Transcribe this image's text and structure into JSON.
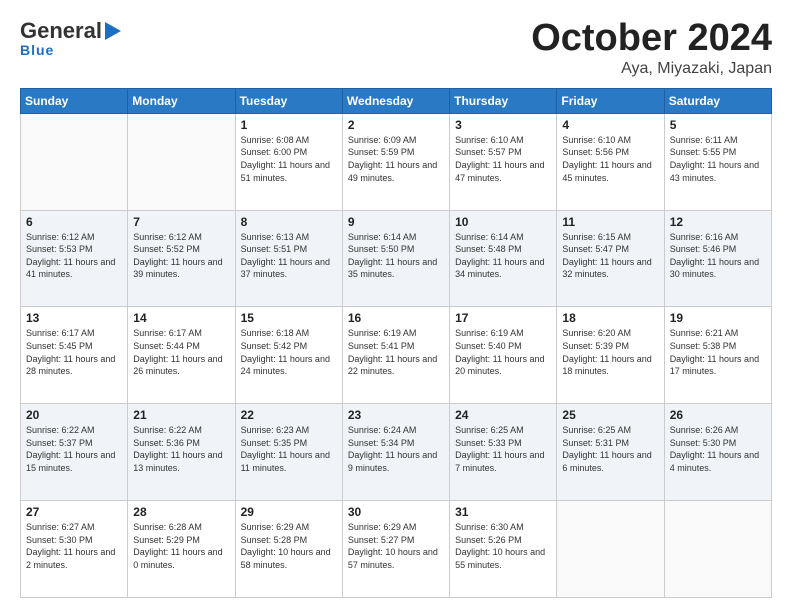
{
  "header": {
    "logo_general": "General",
    "logo_blue": "Blue",
    "month_year": "October 2024",
    "location": "Aya, Miyazaki, Japan"
  },
  "days_of_week": [
    "Sunday",
    "Monday",
    "Tuesday",
    "Wednesday",
    "Thursday",
    "Friday",
    "Saturday"
  ],
  "weeks": [
    [
      {
        "day": "",
        "info": ""
      },
      {
        "day": "",
        "info": ""
      },
      {
        "day": "1",
        "sunrise": "6:08 AM",
        "sunset": "6:00 PM",
        "daylight": "11 hours and 51 minutes."
      },
      {
        "day": "2",
        "sunrise": "6:09 AM",
        "sunset": "5:59 PM",
        "daylight": "11 hours and 49 minutes."
      },
      {
        "day": "3",
        "sunrise": "6:10 AM",
        "sunset": "5:57 PM",
        "daylight": "11 hours and 47 minutes."
      },
      {
        "day": "4",
        "sunrise": "6:10 AM",
        "sunset": "5:56 PM",
        "daylight": "11 hours and 45 minutes."
      },
      {
        "day": "5",
        "sunrise": "6:11 AM",
        "sunset": "5:55 PM",
        "daylight": "11 hours and 43 minutes."
      }
    ],
    [
      {
        "day": "6",
        "sunrise": "6:12 AM",
        "sunset": "5:53 PM",
        "daylight": "11 hours and 41 minutes."
      },
      {
        "day": "7",
        "sunrise": "6:12 AM",
        "sunset": "5:52 PM",
        "daylight": "11 hours and 39 minutes."
      },
      {
        "day": "8",
        "sunrise": "6:13 AM",
        "sunset": "5:51 PM",
        "daylight": "11 hours and 37 minutes."
      },
      {
        "day": "9",
        "sunrise": "6:14 AM",
        "sunset": "5:50 PM",
        "daylight": "11 hours and 35 minutes."
      },
      {
        "day": "10",
        "sunrise": "6:14 AM",
        "sunset": "5:48 PM",
        "daylight": "11 hours and 34 minutes."
      },
      {
        "day": "11",
        "sunrise": "6:15 AM",
        "sunset": "5:47 PM",
        "daylight": "11 hours and 32 minutes."
      },
      {
        "day": "12",
        "sunrise": "6:16 AM",
        "sunset": "5:46 PM",
        "daylight": "11 hours and 30 minutes."
      }
    ],
    [
      {
        "day": "13",
        "sunrise": "6:17 AM",
        "sunset": "5:45 PM",
        "daylight": "11 hours and 28 minutes."
      },
      {
        "day": "14",
        "sunrise": "6:17 AM",
        "sunset": "5:44 PM",
        "daylight": "11 hours and 26 minutes."
      },
      {
        "day": "15",
        "sunrise": "6:18 AM",
        "sunset": "5:42 PM",
        "daylight": "11 hours and 24 minutes."
      },
      {
        "day": "16",
        "sunrise": "6:19 AM",
        "sunset": "5:41 PM",
        "daylight": "11 hours and 22 minutes."
      },
      {
        "day": "17",
        "sunrise": "6:19 AM",
        "sunset": "5:40 PM",
        "daylight": "11 hours and 20 minutes."
      },
      {
        "day": "18",
        "sunrise": "6:20 AM",
        "sunset": "5:39 PM",
        "daylight": "11 hours and 18 minutes."
      },
      {
        "day": "19",
        "sunrise": "6:21 AM",
        "sunset": "5:38 PM",
        "daylight": "11 hours and 17 minutes."
      }
    ],
    [
      {
        "day": "20",
        "sunrise": "6:22 AM",
        "sunset": "5:37 PM",
        "daylight": "11 hours and 15 minutes."
      },
      {
        "day": "21",
        "sunrise": "6:22 AM",
        "sunset": "5:36 PM",
        "daylight": "11 hours and 13 minutes."
      },
      {
        "day": "22",
        "sunrise": "6:23 AM",
        "sunset": "5:35 PM",
        "daylight": "11 hours and 11 minutes."
      },
      {
        "day": "23",
        "sunrise": "6:24 AM",
        "sunset": "5:34 PM",
        "daylight": "11 hours and 9 minutes."
      },
      {
        "day": "24",
        "sunrise": "6:25 AM",
        "sunset": "5:33 PM",
        "daylight": "11 hours and 7 minutes."
      },
      {
        "day": "25",
        "sunrise": "6:25 AM",
        "sunset": "5:31 PM",
        "daylight": "11 hours and 6 minutes."
      },
      {
        "day": "26",
        "sunrise": "6:26 AM",
        "sunset": "5:30 PM",
        "daylight": "11 hours and 4 minutes."
      }
    ],
    [
      {
        "day": "27",
        "sunrise": "6:27 AM",
        "sunset": "5:30 PM",
        "daylight": "11 hours and 2 minutes."
      },
      {
        "day": "28",
        "sunrise": "6:28 AM",
        "sunset": "5:29 PM",
        "daylight": "11 hours and 0 minutes."
      },
      {
        "day": "29",
        "sunrise": "6:29 AM",
        "sunset": "5:28 PM",
        "daylight": "10 hours and 58 minutes."
      },
      {
        "day": "30",
        "sunrise": "6:29 AM",
        "sunset": "5:27 PM",
        "daylight": "10 hours and 57 minutes."
      },
      {
        "day": "31",
        "sunrise": "6:30 AM",
        "sunset": "5:26 PM",
        "daylight": "10 hours and 55 minutes."
      },
      {
        "day": "",
        "info": ""
      },
      {
        "day": "",
        "info": ""
      }
    ]
  ]
}
